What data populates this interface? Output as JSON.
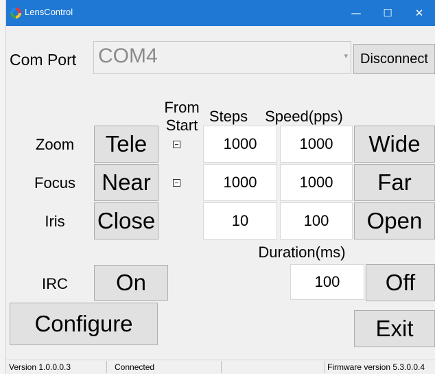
{
  "window": {
    "title": "LensControl",
    "minimize": "—",
    "maximize": "☐",
    "close": "✕"
  },
  "port": {
    "label": "Com Port",
    "value": "COM4",
    "button": "Disconnect"
  },
  "headers": {
    "from_start_1": "From",
    "from_start_2": "Start",
    "steps": "Steps",
    "speed": "Speed(pps)",
    "duration": "Duration(ms)"
  },
  "zoom": {
    "label": "Zoom",
    "minus": "Tele",
    "steps": "1000",
    "speed": "1000",
    "plus": "Wide"
  },
  "focus": {
    "label": "Focus",
    "minus": "Near",
    "steps": "1000",
    "speed": "1000",
    "plus": "Far"
  },
  "iris": {
    "label": "Iris",
    "minus": "Close",
    "steps": "10",
    "speed": "100",
    "plus": "Open"
  },
  "irc": {
    "label": "IRC",
    "on": "On",
    "duration": "100",
    "off": "Off"
  },
  "actions": {
    "configure": "Configure",
    "exit": "Exit"
  },
  "status": {
    "version": "Version 1.0.0.0.3",
    "connection": "Connected",
    "firmware": "Firmware version 5.3.0.0.4"
  }
}
